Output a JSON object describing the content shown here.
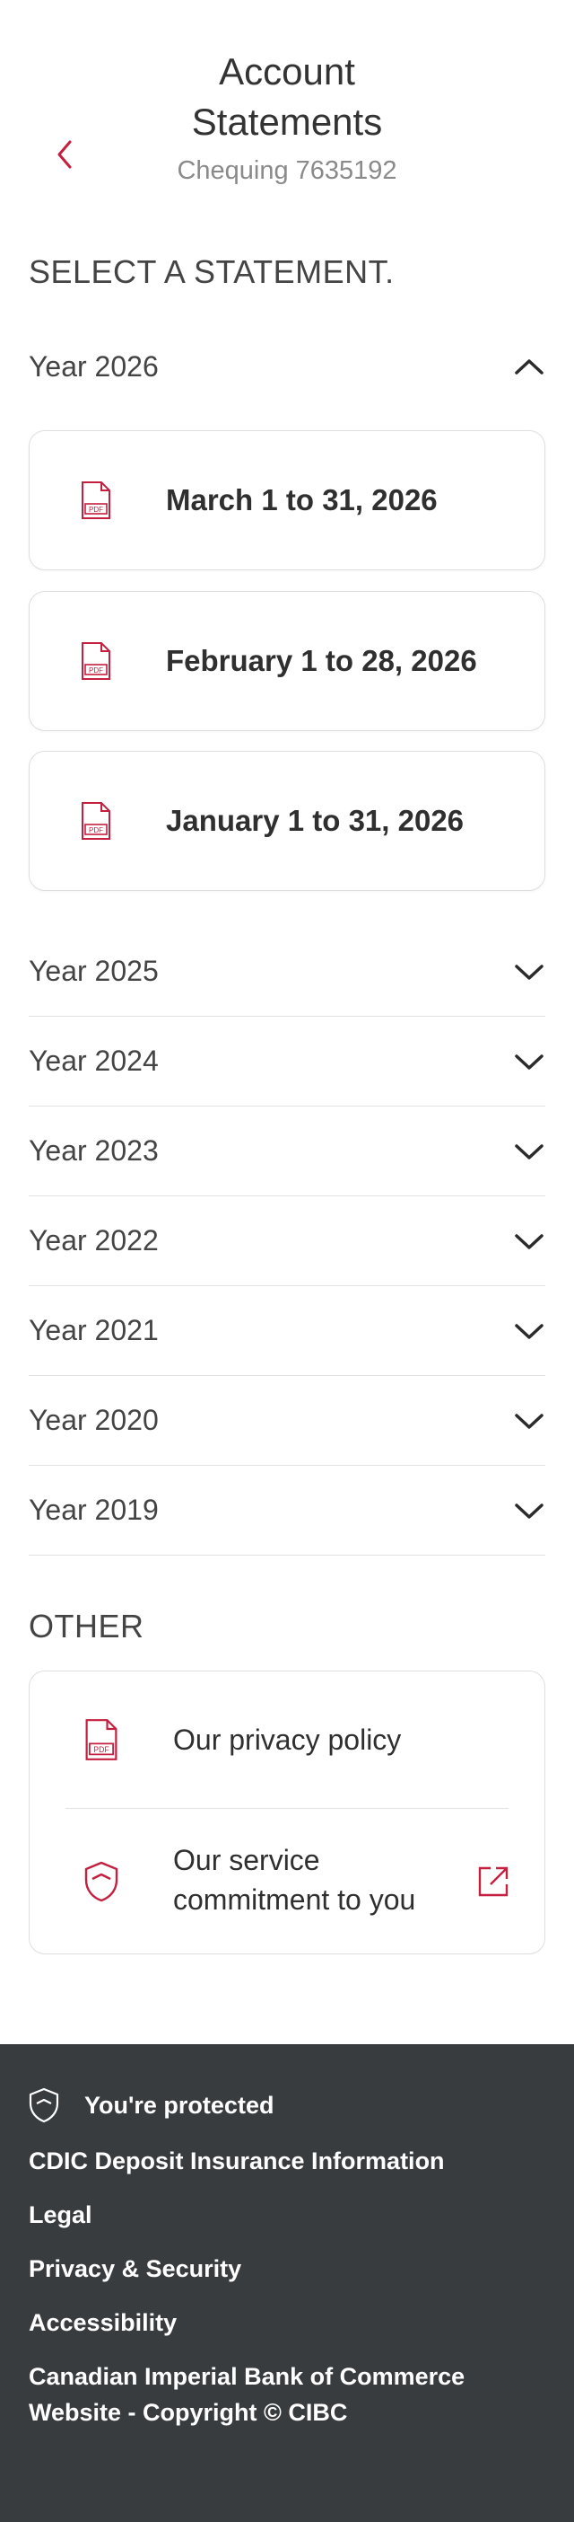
{
  "header": {
    "title_line1": "Account",
    "title_line2": "Statements",
    "account": "Chequing 7635192",
    "back_icon": "chevron-left-icon"
  },
  "statements": {
    "heading": "SELECT A STATEMENT.",
    "open_year": {
      "label": "Year 2026",
      "items": [
        {
          "label": "March 1 to 31, 2026",
          "icon": "pdf-icon"
        },
        {
          "label": "February 1 to 28, 2026",
          "icon": "pdf-icon"
        },
        {
          "label": "January 1 to 31, 2026",
          "icon": "pdf-icon"
        }
      ]
    },
    "years": [
      {
        "label": "Year 2025"
      },
      {
        "label": "Year 2024"
      },
      {
        "label": "Year 2023"
      },
      {
        "label": "Year 2022"
      },
      {
        "label": "Year 2021"
      },
      {
        "label": "Year 2020"
      },
      {
        "label": "Year 2019"
      }
    ]
  },
  "other": {
    "heading": "OTHER",
    "items": [
      {
        "label": "Our privacy policy",
        "icon": "pdf-icon"
      },
      {
        "label": "Our service commitment to you",
        "icon": "shield-icon",
        "trailing_icon": "external-link-icon"
      }
    ]
  },
  "footer": {
    "protected": "You're protected",
    "links": [
      "CDIC Deposit Insurance Information",
      "Legal",
      "Privacy & Security",
      "Accessibility",
      "Canadian Imperial Bank of Commerce Website - Copyright © CIBC"
    ]
  },
  "colors": {
    "accent": "#c41f3e",
    "footer_bg": "#393c3f",
    "text": "#2b2b2b",
    "muted": "#8a8a8a"
  }
}
